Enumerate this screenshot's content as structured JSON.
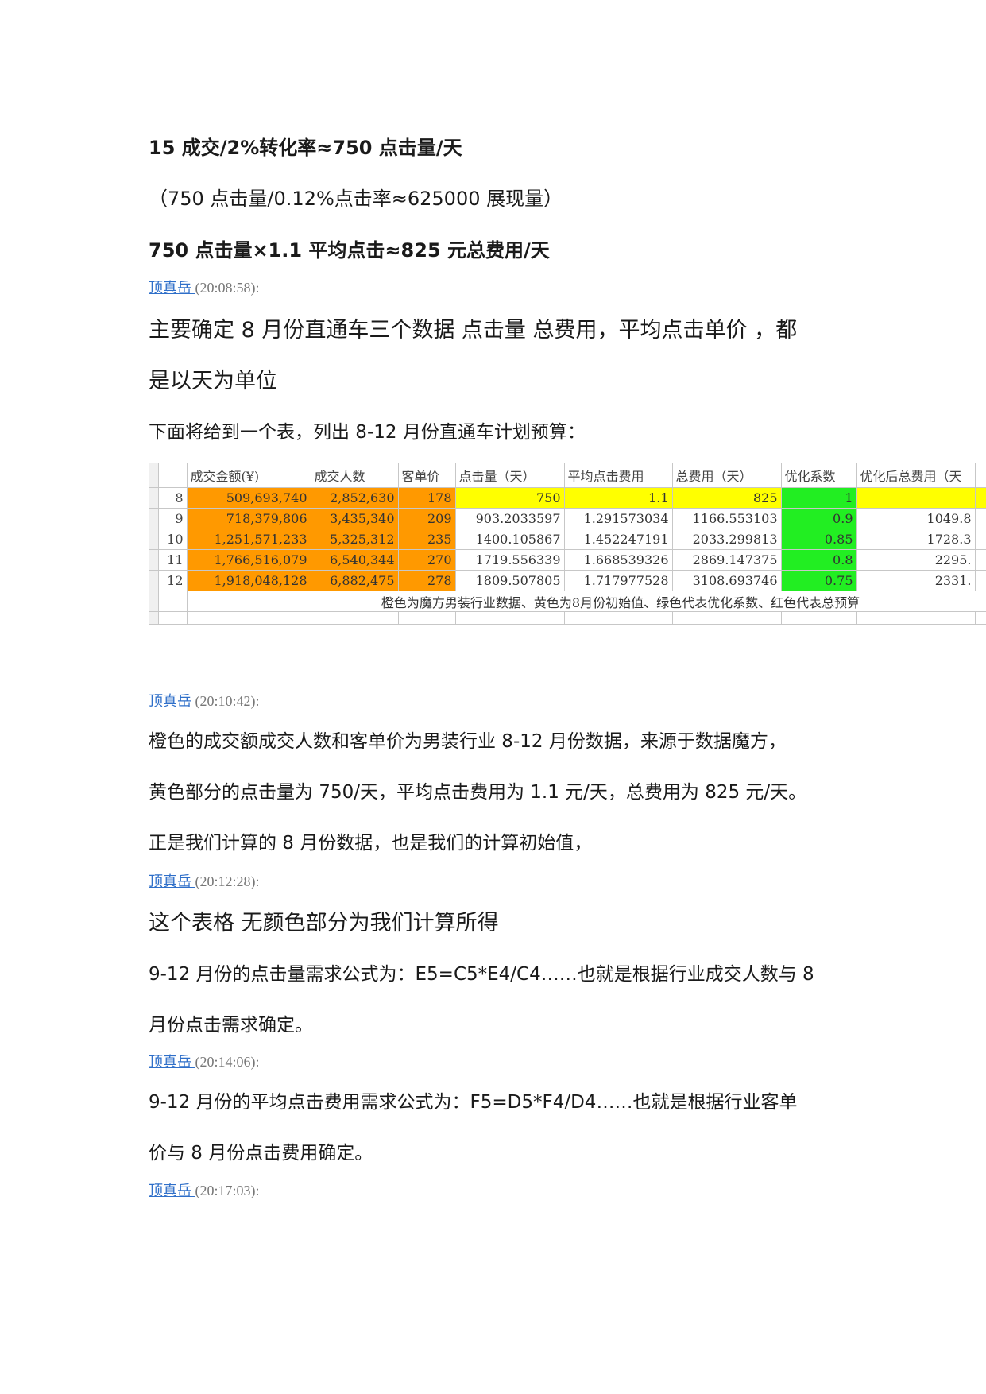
{
  "lines": {
    "l1": "15 成交/2%转化率≈750 点击量/天",
    "l2": "（750 点击量/0.12%点击率≈625000 展现量）",
    "l3": "750 点击量×1.1 平均点击≈825 元总费用/天",
    "l4": "主要确定 8 月份直通车三个数据 点击量 总费用，平均点击单价 ，都",
    "l5": "是以天为单位",
    "l6": "下面将给到一个表，列出 8-12 月份直通车计划预算：",
    "l7": "橙色的成交额成交人数和客单价为男装行业 8-12 月份数据，来源于数据魔方，",
    "l8": "黄色部分的点击量为 750/天，平均点击费用为 1.1 元/天，总费用为 825 元/天。",
    "l9": "正是我们计算的 8 月份数据，也是我们的计算初始值，",
    "l10": "这个表格 无颜色部分为我们计算所得",
    "l11": "9-12 月份的点击量需求公式为：E5=C5*E4/C4……也就是根据行业成交人数与 8",
    "l12": "月份点击需求确定。",
    "l13": "9-12 月份的平均点击费用需求公式为：F5=D5*F4/D4……也就是根据行业客单",
    "l14": "价与 8 月份点击费用确定。"
  },
  "meta": [
    {
      "name": "顶真岳 ",
      "time": "(20:08:58):"
    },
    {
      "name": "顶真岳 ",
      "time": "(20:10:42):"
    },
    {
      "name": "顶真岳 ",
      "time": "(20:12:28):"
    },
    {
      "name": "顶真岳 ",
      "time": "(20:14:06):"
    },
    {
      "name": "顶真岳 ",
      "time": "(20:17:03):"
    }
  ],
  "table": {
    "headers": [
      "成交金额(¥)",
      "成交人数",
      "客单价",
      "点击量（天）",
      "平均点击费用",
      "总费用（天）",
      "优化系数",
      "优化后总费用（天"
    ],
    "rows": [
      {
        "m": "8",
        "c": [
          "509,693,740",
          "2,852,630",
          "178",
          "750",
          "1.1",
          "825",
          "1",
          ""
        ]
      },
      {
        "m": "9",
        "c": [
          "718,379,806",
          "3,435,340",
          "209",
          "903.2033597",
          "1.291573034",
          "1166.553103",
          "0.9",
          "1049.8"
        ]
      },
      {
        "m": "10",
        "c": [
          "1,251,571,233",
          "5,325,312",
          "235",
          "1400.105867",
          "1.452247191",
          "2033.299813",
          "0.85",
          "1728.3"
        ]
      },
      {
        "m": "11",
        "c": [
          "1,766,516,079",
          "6,540,344",
          "270",
          "1719.556339",
          "1.668539326",
          "2869.147375",
          "0.8",
          "2295."
        ]
      },
      {
        "m": "12",
        "c": [
          "1,918,048,128",
          "6,882,475",
          "278",
          "1809.507805",
          "1.717977528",
          "3108.693746",
          "0.75",
          "2331."
        ]
      }
    ],
    "note": "橙色为魔方男装行业数据、黄色为8月份初始值、绿色代表优化系数、红色代表总预算",
    "colors": {
      "orange": "#ff9900",
      "yellow": "#ffff00",
      "green": "#22ee22"
    }
  }
}
